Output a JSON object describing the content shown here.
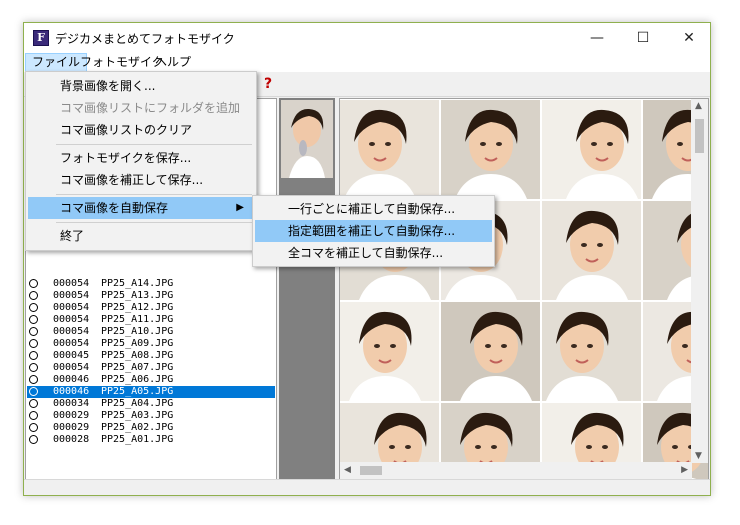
{
  "window": {
    "title": "デジカメまとめてフォトモザイク"
  },
  "menubar": {
    "items": [
      "ファイル",
      "フォトモザイク",
      "ヘルプ"
    ]
  },
  "toolbar": {
    "help": "?"
  },
  "file_menu": {
    "items": [
      {
        "label": "背景画像を開く...",
        "disabled": false
      },
      {
        "label": "コマ画像リストにフォルダを追加",
        "disabled": true
      },
      {
        "label": "コマ画像リストのクリア",
        "disabled": false
      },
      {
        "label": "フォトモザイクを保存...",
        "disabled": false
      },
      {
        "label": "コマ画像を補正して保存...",
        "disabled": false
      },
      {
        "label": "コマ画像を自動保存",
        "disabled": false,
        "submenu": true
      },
      {
        "label": "終了",
        "disabled": false
      }
    ]
  },
  "submenu": {
    "items": [
      "一行ごとに補正して自動保存...",
      "指定範囲を補正して自動保存...",
      "全コマを補正して自動保存..."
    ]
  },
  "file_list": [
    {
      "num": "000054",
      "file": "PP25_A14.JPG"
    },
    {
      "num": "000054",
      "file": "PP25_A13.JPG"
    },
    {
      "num": "000054",
      "file": "PP25_A12.JPG"
    },
    {
      "num": "000054",
      "file": "PP25_A11.JPG"
    },
    {
      "num": "000054",
      "file": "PP25_A10.JPG"
    },
    {
      "num": "000054",
      "file": "PP25_A09.JPG"
    },
    {
      "num": "000045",
      "file": "PP25_A08.JPG"
    },
    {
      "num": "000054",
      "file": "PP25_A07.JPG"
    },
    {
      "num": "000046",
      "file": "PP25_A06.JPG"
    },
    {
      "num": "000046",
      "file": "PP25_A05.JPG",
      "selected": true
    },
    {
      "num": "000034",
      "file": "PP25_A04.JPG"
    },
    {
      "num": "000029",
      "file": "PP25_A03.JPG"
    },
    {
      "num": "000029",
      "file": "PP25_A02.JPG"
    },
    {
      "num": "000028",
      "file": "PP25_A01.JPG"
    }
  ],
  "colors": {
    "selection": "#0078d7",
    "menu_highlight": "#91c9f7"
  }
}
